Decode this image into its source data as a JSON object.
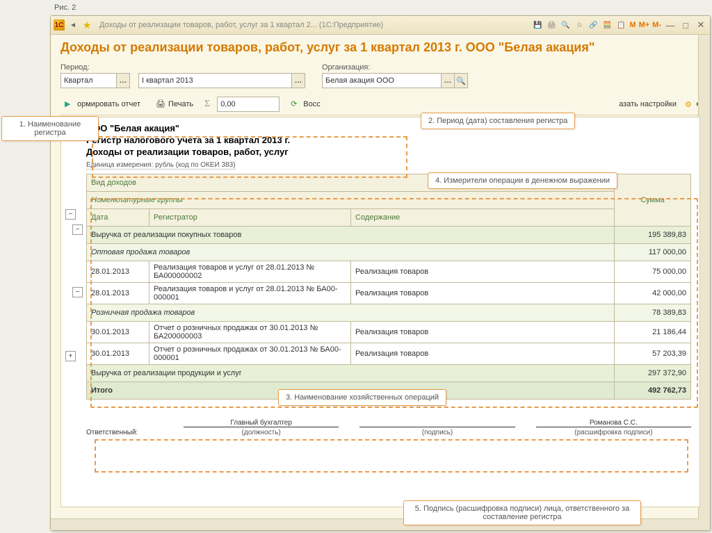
{
  "figure": "Рис. 2",
  "titlebar": {
    "text": "Доходы от реализации товаров, работ, услуг за 1 квартал 2...   (1С:Предприятие)",
    "mem": [
      "M",
      "M+",
      "M-"
    ]
  },
  "page_title": "Доходы от реализации товаров, работ, услуг за 1 квартал 2013 г. ООО \"Белая акация\"",
  "fields": {
    "period_label": "Период:",
    "period_type": "Квартал",
    "period_value": "I квартал 2013",
    "org_label": "Организация:",
    "org_value": "Белая акация ООО"
  },
  "toolbar": {
    "form_report": "ормировать отчет",
    "print": "Печать",
    "sigma_value": "0,00",
    "restore": "Восс",
    "show_settings": "азать настройки"
  },
  "report": {
    "company": "ООО \"Белая акация\"",
    "register": "Регистр налогового учета за 1 квартал 2013 г.",
    "title": "Доходы от реализации товаров, работ, услуг",
    "unit": "Единица измерения:   рубль (код по ОКЕИ 383)",
    "headers": {
      "income_type": "Вид доходов",
      "nom_groups": "Номенклатурные группы",
      "date": "Дата",
      "registrator": "Регистратор",
      "content": "Содержание",
      "sum": "Сумма"
    },
    "rows": [
      {
        "type": "lvl0",
        "c1": "Выручка от реализации покупных товаров",
        "sum": "195 389,83"
      },
      {
        "type": "lvl1",
        "c1": "Оптовая продажа товаров",
        "sum": "117 000,00"
      },
      {
        "type": "detail",
        "date": "28.01.2013",
        "reg": "Реализация товаров и услуг от 28.01.2013 № БА000000002",
        "cont": "Реализация товаров",
        "sum": "75 000,00"
      },
      {
        "type": "detail",
        "date": "28.01.2013",
        "reg": "Реализация товаров и услуг от 28.01.2013 № БА00-000001",
        "cont": "Реализация товаров",
        "sum": "42 000,00"
      },
      {
        "type": "lvl1",
        "c1": "Розничная продажа товаров",
        "sum": "78 389,83"
      },
      {
        "type": "detail",
        "date": "30.01.2013",
        "reg": "Отчет о розничных продажах от 30.01.2013 № БА200000003",
        "cont": "Реализация товаров",
        "sum": "21 186,44"
      },
      {
        "type": "detail",
        "date": "30.01.2013",
        "reg": "Отчет о розничных продажах от 30.01.2013 № БА00-000001",
        "cont": "Реализация товаров",
        "sum": "57 203,39"
      },
      {
        "type": "lvl0",
        "c1": "Выручка от реализации продукции и услуг",
        "sum": "297 372,90"
      },
      {
        "type": "total",
        "c1": "Итого",
        "sum": "492 762,73"
      }
    ],
    "sign": {
      "responsible": "Ответственный:",
      "position_val": "Главный бухгалтер",
      "position": "(должность)",
      "signature": "(подпись)",
      "name_val": "Романова С.С.",
      "name": "(расшифровка подписи)"
    }
  },
  "callouts": {
    "c1": "1. Наименование регистра",
    "c2": "2. Период (дата) составления регистра",
    "c3": "3. Наименование хозяйственных операций",
    "c4": "4. Измерители операции в денежном выражении",
    "c5": "5. Подпись (расшифровка подписи) лица, ответственного за составление регистра"
  }
}
